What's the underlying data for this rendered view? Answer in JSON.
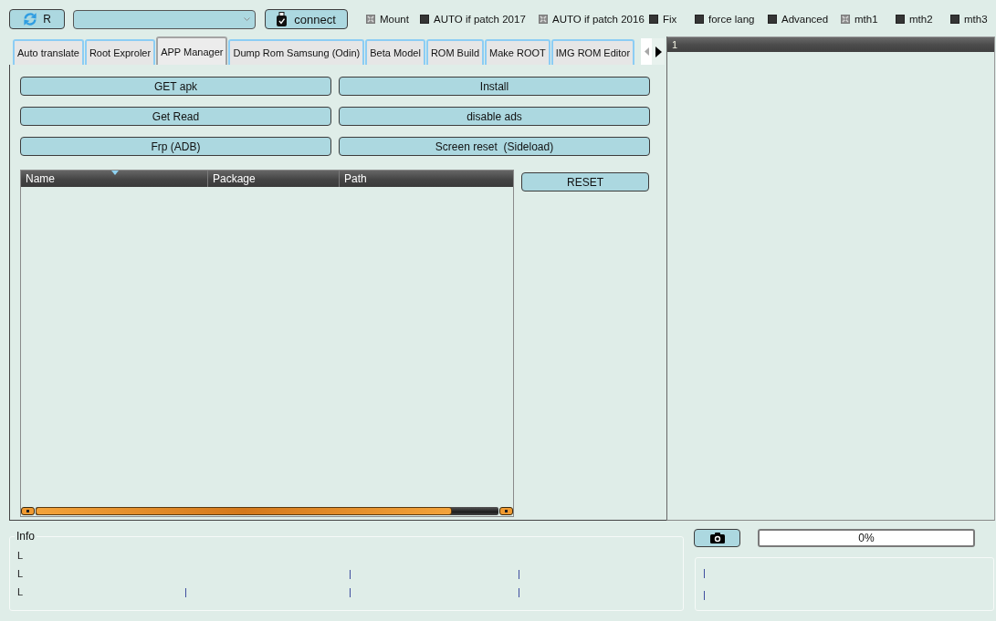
{
  "toolbar": {
    "refresh_button": {
      "label": "R"
    },
    "connect_button": {
      "label": "connect"
    },
    "options": [
      {
        "label": "Mount",
        "checked": true
      },
      {
        "label": "AUTO if patch 2017",
        "checked": false
      },
      {
        "label": "AUTO if patch 2016",
        "checked": true
      },
      {
        "label": "Fix",
        "checked": false
      },
      {
        "label": "force lang",
        "checked": false
      },
      {
        "label": "Advanced",
        "checked": false
      },
      {
        "label": "mth1",
        "checked": true
      },
      {
        "label": "mth2",
        "checked": false
      },
      {
        "label": "mth3",
        "checked": false
      }
    ]
  },
  "tabs": [
    {
      "label": "Auto translate",
      "selected": false
    },
    {
      "label": "Root Exproler",
      "selected": false
    },
    {
      "label": "APP Manager",
      "selected": true
    },
    {
      "label": "Dump Rom Samsung (Odin)",
      "selected": false
    },
    {
      "label": "Beta Model",
      "selected": false
    },
    {
      "label": "ROM Build",
      "selected": false
    },
    {
      "label": "Make ROOT",
      "selected": false
    },
    {
      "label": "IMG ROM Editor",
      "selected": false
    }
  ],
  "app_manager": {
    "buttons": [
      "GET apk",
      "Install",
      "Get Read",
      "disable ads",
      "Frp (ADB)",
      "Screen reset  (Sideload)"
    ],
    "table": {
      "columns": [
        {
          "label": "Name",
          "sorted": true
        },
        {
          "label": "Package",
          "sorted": false
        },
        {
          "label": "Path",
          "sorted": false
        }
      ]
    },
    "reset_button": {
      "label": "RESET"
    }
  },
  "output_panel": {
    "header": "1"
  },
  "info": {
    "title": "Info",
    "rows": [
      {
        "column_1": "L"
      },
      {
        "column_1": "L",
        "column_3": "|",
        "column_4": "|"
      },
      {
        "column_1": "L",
        "column_2": "|",
        "column_3": "|",
        "column_4": "|"
      }
    ]
  },
  "progress": {
    "level": 0,
    "reading": "0%"
  },
  "log": [
    "|",
    "|"
  ]
}
